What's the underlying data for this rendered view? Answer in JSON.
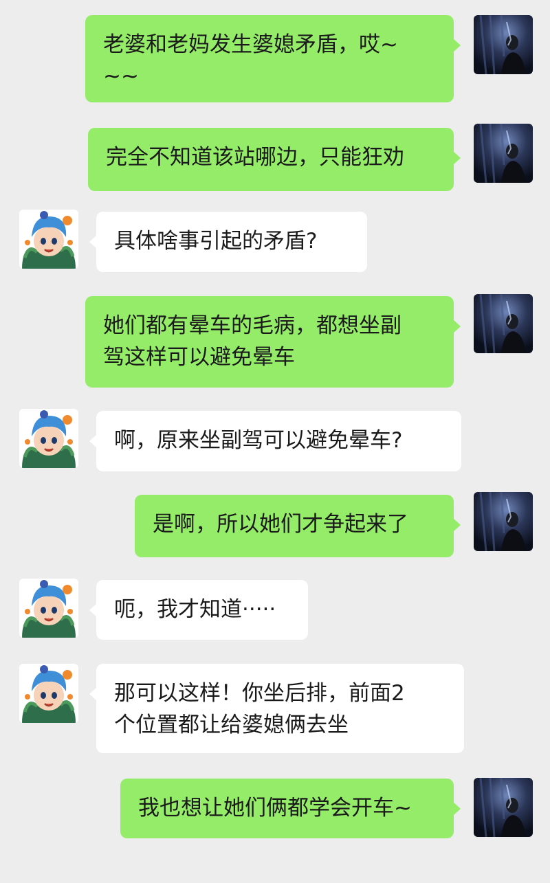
{
  "chat": {
    "messages": [
      {
        "sender": "me",
        "text": "老婆和老妈发生婆媳矛盾，哎~\n~~"
      },
      {
        "sender": "me",
        "text": "完全不知道该站哪边，只能狂劝"
      },
      {
        "sender": "other",
        "text": "具体啥事引起的矛盾?"
      },
      {
        "sender": "me",
        "text": "她们都有晕车的毛病，都想坐副\n驾这样可以避免晕车"
      },
      {
        "sender": "other",
        "text": "啊，原来坐副驾可以避免晕车?"
      },
      {
        "sender": "me",
        "text": "是啊，所以她们才争起来了"
      },
      {
        "sender": "other",
        "text": "呃，我才知道·····"
      },
      {
        "sender": "other",
        "text": "那可以这样！你坐后排，前面2\n个位置都让给婆媳俩去坐"
      },
      {
        "sender": "me",
        "text": "我也想让她们俩都学会开车~"
      }
    ]
  },
  "colors": {
    "background": "#ededed",
    "my_bubble": "#95ec69",
    "other_bubble": "#ffffff",
    "text": "#1a1a1a"
  },
  "icons": {
    "my_avatar": "dark-portrait-avatar-icon",
    "other_avatar": "cartoon-boy-avatar-icon"
  }
}
